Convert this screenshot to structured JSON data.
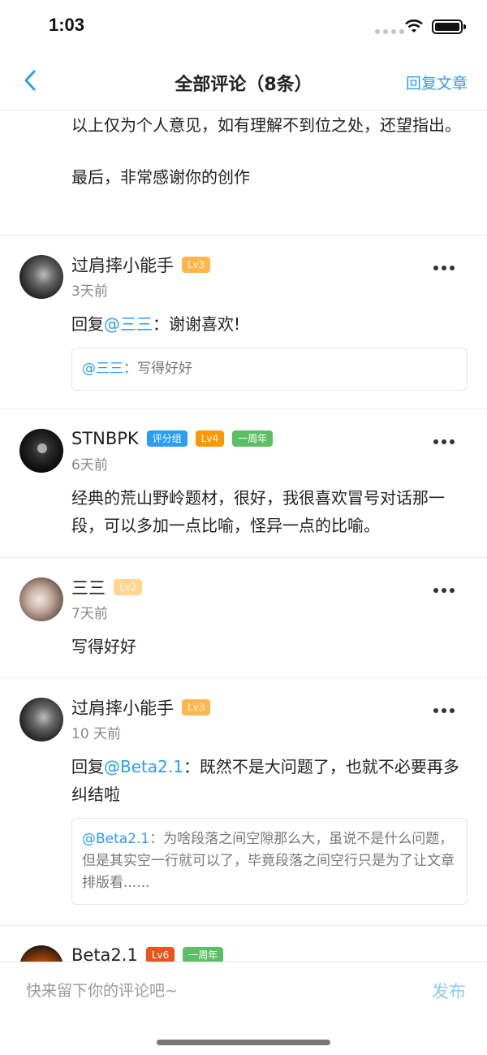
{
  "status_bar": {
    "time": "1:03"
  },
  "nav": {
    "title": "全部评论（8条）",
    "action": "回复文章",
    "back_icon": "chevron-left-icon"
  },
  "prev_comment_tail": {
    "line1": "以上仅为个人意见，如有理解不到位之处，还望指出。",
    "line2": "最后，非常感谢你的创作"
  },
  "comments": [
    {
      "user": "过肩摔小能手",
      "badges": [
        "Lv3"
      ],
      "time": "3天前",
      "reply_prefix": "回复",
      "mention": "@三三",
      "text": "：谢谢喜欢!",
      "quote_mention": "@三三",
      "quote_text": "：写得好好"
    },
    {
      "user": "STNBPK",
      "badges": [
        "评分组",
        "Lv4",
        "一周年"
      ],
      "time": "6天前",
      "text": "经典的荒山野岭题材，很好，我很喜欢冒号对话那一段，可以多加一点比喻，怪异一点的比喻。"
    },
    {
      "user": "三三",
      "badges": [
        "Lv2"
      ],
      "time": "7天前",
      "text": "写得好好"
    },
    {
      "user": "过肩摔小能手",
      "badges": [
        "Lv3"
      ],
      "time": "10 天前",
      "reply_prefix": "回复",
      "mention": "@Beta2.1",
      "text": "：既然不是大问题了，也就不必要再多纠结啦",
      "quote_mention": "@Beta2.1",
      "quote_text": "：为啥段落之间空隙那么大，虽说不是什么问题，但是其实空一行就可以了，毕竟段落之间空行只是为了让文章排版看......"
    },
    {
      "user": "Beta2.1",
      "badges": [
        "Lv6",
        "一周年"
      ]
    }
  ],
  "input": {
    "placeholder": "快来留下你的评论吧~",
    "value": ""
  },
  "publish": "发布"
}
